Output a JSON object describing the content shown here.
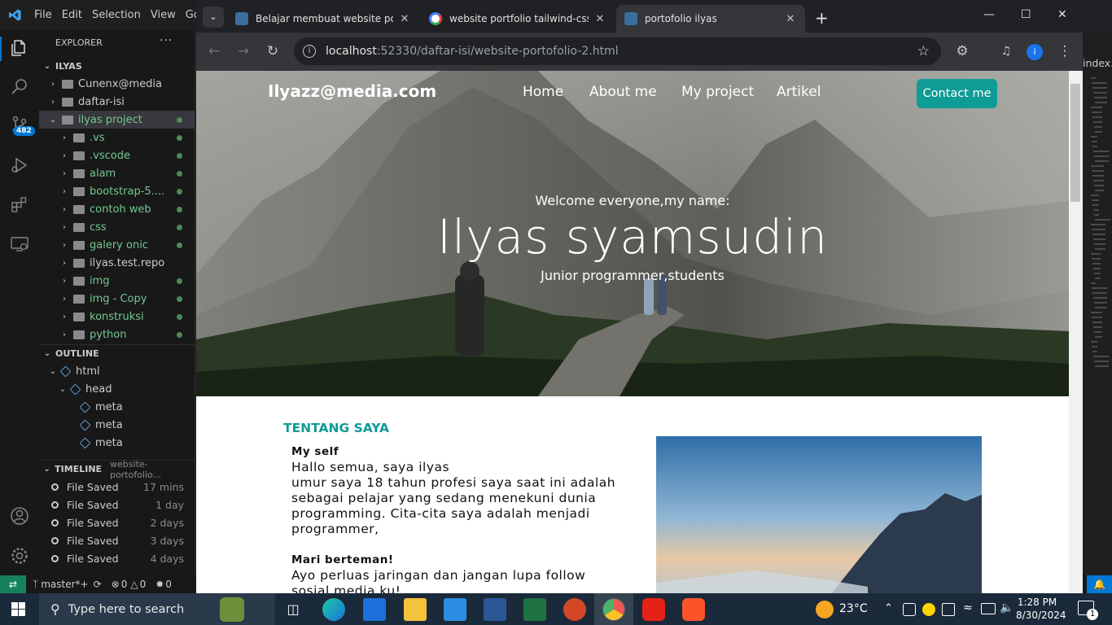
{
  "vscode": {
    "menu": [
      "File",
      "Edit",
      "Selection",
      "View",
      "Go"
    ],
    "activity_badge": "482",
    "explorer": {
      "title": "EXPLORER",
      "more": "···",
      "root": "ILYAS",
      "items": [
        {
          "label": "Cunenx@media",
          "color": "#cccccc",
          "icon": "folder-icon",
          "open": false,
          "dot": false,
          "indent": 1
        },
        {
          "label": "daftar-isi",
          "color": "#cccccc",
          "icon": "folder-icon",
          "open": false,
          "dot": false,
          "indent": 1
        },
        {
          "label": "ilyas project",
          "color": "#73c991",
          "icon": "folder-icon",
          "open": true,
          "dot": true,
          "indent": 1
        },
        {
          "label": ".vs",
          "color": "#73c991",
          "icon": "folder-icon",
          "open": false,
          "dot": true,
          "indent": 2
        },
        {
          "label": ".vscode",
          "color": "#73c991",
          "icon": "folder-icon",
          "open": false,
          "dot": true,
          "indent": 2
        },
        {
          "label": "alam",
          "color": "#73c991",
          "icon": "folder-icon",
          "open": false,
          "dot": true,
          "indent": 2
        },
        {
          "label": "bootstrap-5....",
          "color": "#73c991",
          "icon": "folder-icon",
          "open": false,
          "dot": true,
          "indent": 2
        },
        {
          "label": "contoh web",
          "color": "#73c991",
          "icon": "folder-icon",
          "open": false,
          "dot": true,
          "indent": 2
        },
        {
          "label": "css",
          "color": "#73c991",
          "icon": "folder-icon",
          "open": false,
          "dot": true,
          "indent": 2
        },
        {
          "label": "galery onic",
          "color": "#73c991",
          "icon": "folder-icon",
          "open": false,
          "dot": true,
          "indent": 2
        },
        {
          "label": "ilyas.test.repo",
          "color": "#cccccc",
          "icon": "folder-icon",
          "open": false,
          "dot": false,
          "indent": 2
        },
        {
          "label": "img",
          "color": "#73c991",
          "icon": "folder-icon",
          "open": false,
          "dot": true,
          "indent": 2
        },
        {
          "label": "img - Copy",
          "color": "#73c991",
          "icon": "folder-icon",
          "open": false,
          "dot": true,
          "indent": 2
        },
        {
          "label": "konstruksi",
          "color": "#73c991",
          "icon": "folder-icon",
          "open": false,
          "dot": true,
          "indent": 2
        },
        {
          "label": "python",
          "color": "#73c991",
          "icon": "folder-icon",
          "open": false,
          "dot": true,
          "indent": 2
        }
      ]
    },
    "outline": {
      "title": "OUTLINE",
      "items": [
        {
          "label": "html",
          "indent": 1
        },
        {
          "label": "head",
          "indent": 2
        },
        {
          "label": "meta",
          "indent": 3
        },
        {
          "label": "meta",
          "indent": 3
        },
        {
          "label": "meta",
          "indent": 3
        }
      ]
    },
    "timeline": {
      "title": "TIMELINE",
      "file": "website-portofolio...",
      "items": [
        {
          "label": "File Saved",
          "time": "17 mins"
        },
        {
          "label": "File Saved",
          "time": "1 day"
        },
        {
          "label": "File Saved",
          "time": "2 days"
        },
        {
          "label": "File Saved",
          "time": "3 days"
        },
        {
          "label": "File Saved",
          "time": "4 days"
        }
      ]
    },
    "status": {
      "branch": "master*+",
      "errors": "0",
      "warnings": "0",
      "ports": "0"
    },
    "editor_tab": "index.ex"
  },
  "chrome": {
    "tabs": [
      {
        "title": "Belajar membuat website porto",
        "favicon_color": "#3b6e9e",
        "active": false
      },
      {
        "title": "website portfolio tailwind-css sa",
        "favicon_color": "#ffffff",
        "active": false
      },
      {
        "title": "portofolio ilyas",
        "favicon_color": "#3b6e9e",
        "active": true
      }
    ],
    "new_tab": "+",
    "url_host": "localhost",
    "url_path": ":52330/daftar-isi/website-portofolio-2.html",
    "profile_initial": "i"
  },
  "site": {
    "brand": "Ilyazz@media.com",
    "nav": [
      "Home",
      "About me",
      "My project",
      "Artikel"
    ],
    "contact": "Contact me",
    "welcome": "Welcome everyone,my name:",
    "name": "Ilyas syamsudin",
    "role": "Junior programmer,students",
    "about_heading": "TENTANG SAYA",
    "myself_title": "My self",
    "myself_lines": [
      "Hallo semua, saya ilyas",
      "umur saya 18 tahun profesi saya saat ini adalah",
      "sebagai pelajar yang sedang menekuni dunia",
      "programming. Cita-cita saya adalah menjadi",
      "programmer,"
    ],
    "friend_title": "Mari berteman!",
    "friend_lines": [
      "Ayo perluas jaringan dan jangan lupa follow",
      "sosial media ku!"
    ],
    "accent": "#0f9b96"
  },
  "taskbar": {
    "search_placeholder": "Type here to search",
    "weather": "23°C",
    "time": "1:28 PM",
    "date": "8/30/2024",
    "notifications": "1"
  }
}
